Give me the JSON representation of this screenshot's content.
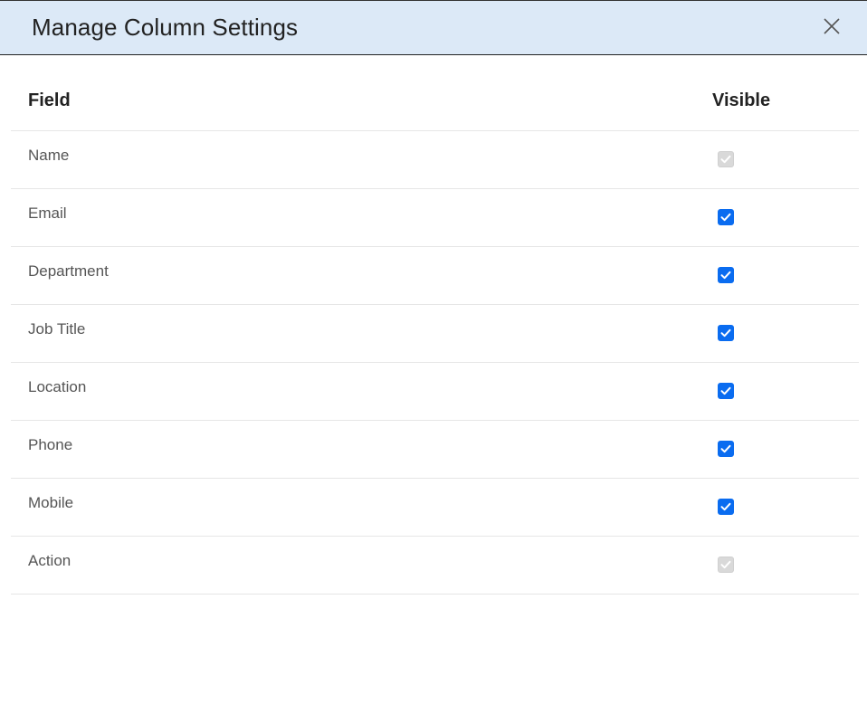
{
  "dialog": {
    "title": "Manage Column Settings",
    "close_icon": "close-icon",
    "colors": {
      "header_bg": "#dce9f7",
      "checkbox_accent": "#0a6cf0",
      "checkbox_disabled": "#d9d9d9"
    }
  },
  "table": {
    "headers": {
      "field": "Field",
      "visible": "Visible"
    },
    "rows": [
      {
        "field": "Name",
        "visible": true,
        "disabled": true
      },
      {
        "field": "Email",
        "visible": true,
        "disabled": false
      },
      {
        "field": "Department",
        "visible": true,
        "disabled": false
      },
      {
        "field": "Job Title",
        "visible": true,
        "disabled": false
      },
      {
        "field": "Location",
        "visible": true,
        "disabled": false
      },
      {
        "field": "Phone",
        "visible": true,
        "disabled": false
      },
      {
        "field": "Mobile",
        "visible": true,
        "disabled": false
      },
      {
        "field": "Action",
        "visible": true,
        "disabled": true
      }
    ]
  }
}
